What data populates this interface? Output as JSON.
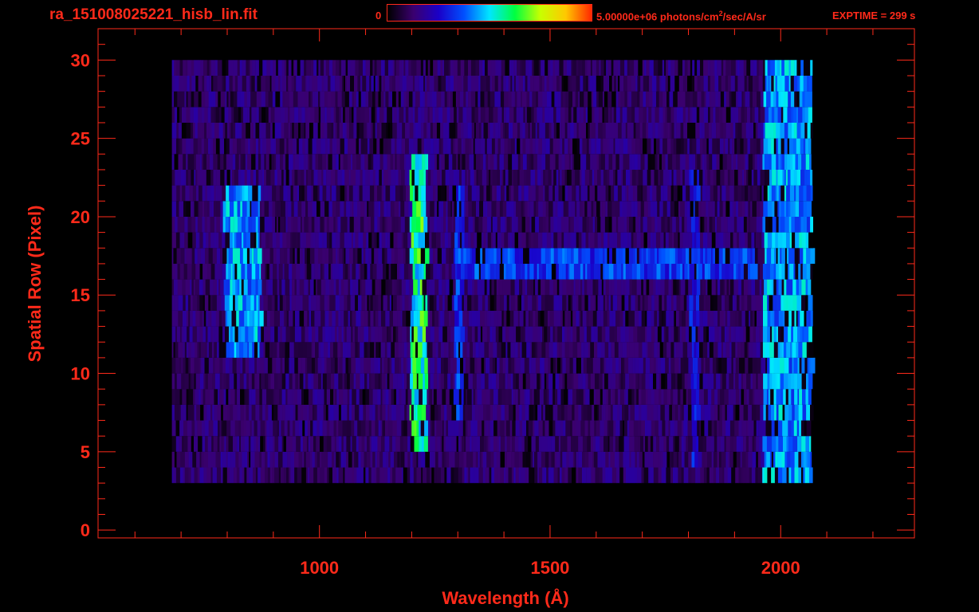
{
  "header": {
    "filename": "ra_151008025221_hisb_lin.fit",
    "colorbar_min": "0",
    "colorbar_max_prefix": "5.00000e+06 photons/cm",
    "colorbar_max_sup": "2",
    "colorbar_max_suffix": "/sec/A/sr",
    "exptime": "EXPTIME = 299 s"
  },
  "colors": {
    "axis": "#ff2a1a",
    "background": "#000000",
    "colormap": [
      "#000000",
      "#3a006e",
      "#1a00c8",
      "#0050ff",
      "#00e6ff",
      "#00ff40",
      "#c8ff00",
      "#ffc800",
      "#ff2a00"
    ]
  },
  "chart_data": {
    "type": "heatmap",
    "title": "ra_151008025221_hisb_lin.fit",
    "xlabel": "Wavelength (Å)",
    "ylabel": "Spatial Row (Pixel)",
    "xlim": [
      520,
      2290
    ],
    "ylim": [
      -0.5,
      32
    ],
    "x_ticks": [
      1000,
      1500,
      2000
    ],
    "y_ticks": [
      0,
      5,
      10,
      15,
      20,
      25,
      30
    ],
    "colorbar_range": [
      0,
      5000000
    ],
    "colorbar_units": "photons/cm^2/sec/A/sr",
    "data_extent": {
      "x": [
        680,
        2065
      ],
      "rows": [
        3,
        30
      ]
    },
    "features": [
      {
        "x": [
          790,
          870
        ],
        "rows": [
          11,
          22
        ],
        "level": 0.45
      },
      {
        "x": [
          1195,
          1230
        ],
        "rows": [
          5,
          24
        ],
        "level": 0.6
      },
      {
        "x": [
          1290,
          1310
        ],
        "rows": [
          7,
          22
        ],
        "level": 0.35
      },
      {
        "x": [
          1300,
          1950
        ],
        "rows": [
          16,
          18
        ],
        "level": 0.35
      },
      {
        "x": [
          1800,
          1820
        ],
        "rows": [
          4,
          23
        ],
        "level": 0.3
      },
      {
        "x": [
          1960,
          2065
        ],
        "rows": [
          3,
          30
        ],
        "level": 0.45
      }
    ]
  }
}
